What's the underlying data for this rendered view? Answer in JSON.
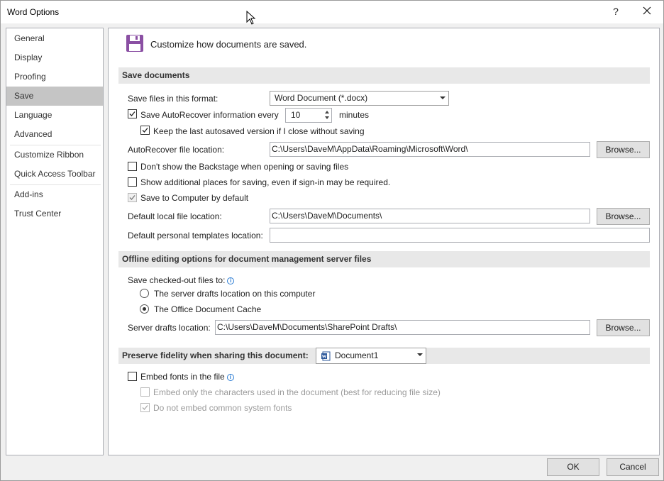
{
  "window": {
    "title": "Word Options",
    "help_label": "?"
  },
  "nav": {
    "items": [
      {
        "label": "General"
      },
      {
        "label": "Display"
      },
      {
        "label": "Proofing"
      },
      {
        "label": "Save",
        "selected": true
      },
      {
        "label": "Language"
      },
      {
        "label": "Advanced"
      },
      {
        "label": "Customize Ribbon"
      },
      {
        "label": "Quick Access Toolbar"
      },
      {
        "label": "Add-ins"
      },
      {
        "label": "Trust Center"
      }
    ]
  },
  "header": {
    "text": "Customize how documents are saved."
  },
  "save_documents": {
    "section_title": "Save documents",
    "format_label": "Save files in this format:",
    "format_value": "Word Document (*.docx)",
    "autorecover_label": "Save AutoRecover information every",
    "autorecover_checked": true,
    "autorecover_minutes": "10",
    "minutes_label": "minutes",
    "keep_last_label": "Keep the last autosaved version if I close without saving",
    "keep_last_checked": true,
    "autorecover_location_label": "AutoRecover file location:",
    "autorecover_location_value": "C:\\Users\\DaveM\\AppData\\Roaming\\Microsoft\\Word\\",
    "browse_label": "Browse...",
    "backstage_label": "Don't show the Backstage when opening or saving files",
    "backstage_checked": false,
    "additional_places_label": "Show additional places for saving, even if sign-in may be required.",
    "additional_places_checked": false,
    "save_computer_label": "Save to Computer by default",
    "save_computer_checked": true,
    "default_local_label": "Default local file location:",
    "default_local_value": "C:\\Users\\DaveM\\Documents\\",
    "templates_label": "Default personal templates location:",
    "templates_value": ""
  },
  "offline": {
    "section_title": "Offline editing options for document management server files",
    "checked_out_label": "Save checked-out files to:",
    "info_icon": "i",
    "server_drafts_option": "The server drafts location on this computer",
    "office_cache_option": "The Office Document Cache",
    "selected_option": "office_cache",
    "server_drafts_label": "Server drafts location:",
    "server_drafts_value": "C:\\Users\\DaveM\\Documents\\SharePoint Drafts\\"
  },
  "fidelity": {
    "section_title": "Preserve fidelity when sharing this document:",
    "document_value": "Document1",
    "embed_fonts_label": "Embed fonts in the file",
    "embed_fonts_checked": false,
    "embed_only_label": "Embed only the characters used in the document (best for reducing file size)",
    "do_not_embed_label": "Do not embed common system fonts",
    "do_not_embed_checked": true
  },
  "footer": {
    "ok_label": "OK",
    "cancel_label": "Cancel"
  },
  "colors": {
    "save_icon": "#8a4fa3",
    "selected_nav": "#c5c5c5",
    "section_bg": "#e8e8e8"
  }
}
